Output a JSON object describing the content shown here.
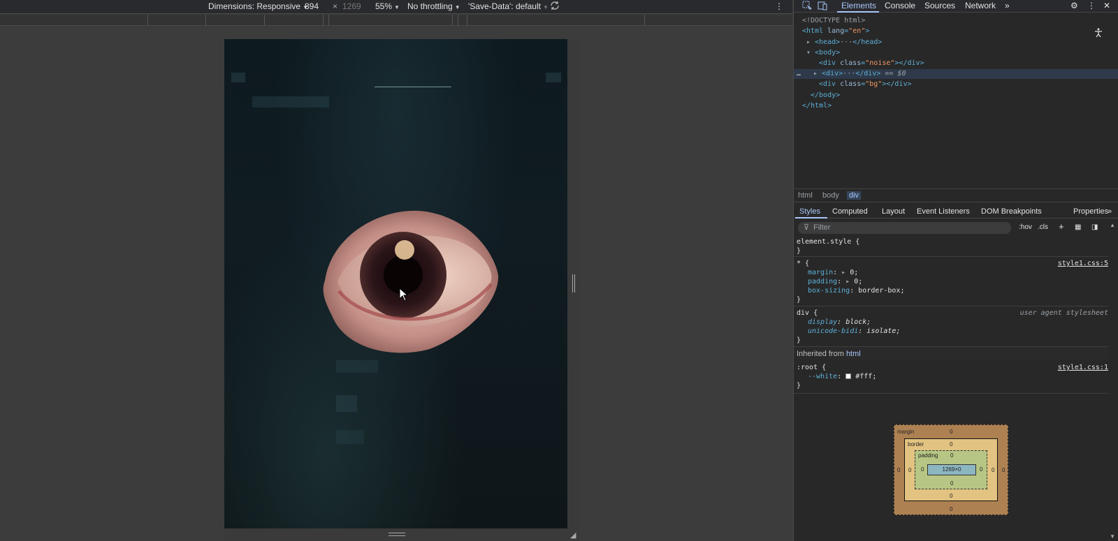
{
  "toolbar": {
    "dimensions_label": "Dimensions: Responsive",
    "width": "894",
    "times": "×",
    "height": "1269",
    "zoom": "55%",
    "throttling": "No throttling",
    "save_data": "'Save-Data': default"
  },
  "devtools": {
    "tabs": [
      "Elements",
      "Console",
      "Sources",
      "Network"
    ],
    "dom_lines": {
      "doctype": "<!DOCTYPE html>",
      "html_open": "<html",
      "html_attr": "lang",
      "html_val": "\"en\"",
      "head": "<head>",
      "head_close": "</head>",
      "body_open": "<body>",
      "div_noise_tag": "<div",
      "div_noise_attr": "class",
      "div_noise_val": "\"noise\"",
      "div_close": "></div>",
      "div_sel_open": "<div>",
      "div_sel_close": "</div>",
      "div_sel_marker": "== $0",
      "div_bg_val": "\"bg\"",
      "body_close": "</body>",
      "html_close": "</html>",
      "ellipsis": "…",
      "dots": "···"
    },
    "breadcrumbs": [
      "html",
      "body",
      "div"
    ],
    "sub_tabs": [
      "Styles",
      "Computed",
      "Layout",
      "Event Listeners",
      "DOM Breakpoints",
      "Properties"
    ],
    "filter_placeholder": "Filter",
    "filter_hov": ":hov",
    "filter_cls": ".cls",
    "styles": {
      "element_style": "element.style {",
      "close": "}",
      "star_selector": "* {",
      "star_source": "style1.css:5",
      "margin_prop": "margin",
      "margin_val": "0;",
      "padding_prop": "padding",
      "padding_val": "0;",
      "boxsizing_prop": "box-sizing",
      "boxsizing_val": "border-box;",
      "div_selector": "div {",
      "div_source": "user agent stylesheet",
      "display_prop": "display",
      "display_val": "block;",
      "bidi_prop": "unicode-bidi",
      "bidi_val": "isolate;",
      "inherited_label": "Inherited from",
      "inherited_from": "html",
      "root_selector": ":root {",
      "root_source": "style1.css:1",
      "white_prop": "--white",
      "white_val": "#fff;"
    },
    "box_model": {
      "margin_label": "margin",
      "border_label": "border",
      "padding_label": "padding",
      "content": "1269×0",
      "zero": "0"
    }
  },
  "colors": {
    "accent": "#a8c7fa",
    "eye_iris": "#2a1418",
    "eye_skin": "#c89890"
  }
}
